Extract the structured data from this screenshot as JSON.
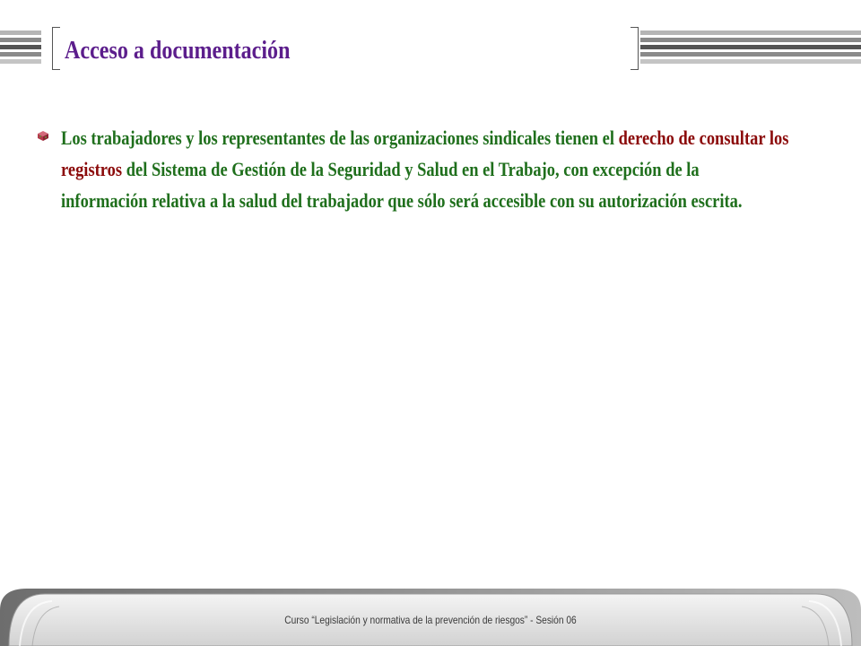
{
  "slide": {
    "title": "Acceso a documentación",
    "bullets": [
      {
        "segments": [
          {
            "text": "Los trabajadores y los representantes de las organizaciones sindicales tienen el ",
            "highlight": false
          },
          {
            "text": "derecho de consultar los registros",
            "highlight": true
          },
          {
            "text": " del Sistema de Gestión de la Seguridad y Salud en el Trabajo, con excepción de la información relativa a la salud del trabajador que sólo será accesible con su autorización escrita.",
            "highlight": false
          }
        ]
      }
    ]
  },
  "footer": {
    "text": "Curso “Legislación y normativa de la prevención de riesgos”  -  Sesión 06"
  },
  "colors": {
    "title": "#5c1e8c",
    "body_text": "#1f6f1c",
    "highlight_text": "#8b0a0a",
    "footer_text": "#3a3a3a",
    "bullet_icon": "#b23a4a"
  },
  "icons": {
    "bullet": "red-cube-bullet-icon",
    "header_left": "striped-bars",
    "header_right": "striped-bars"
  }
}
